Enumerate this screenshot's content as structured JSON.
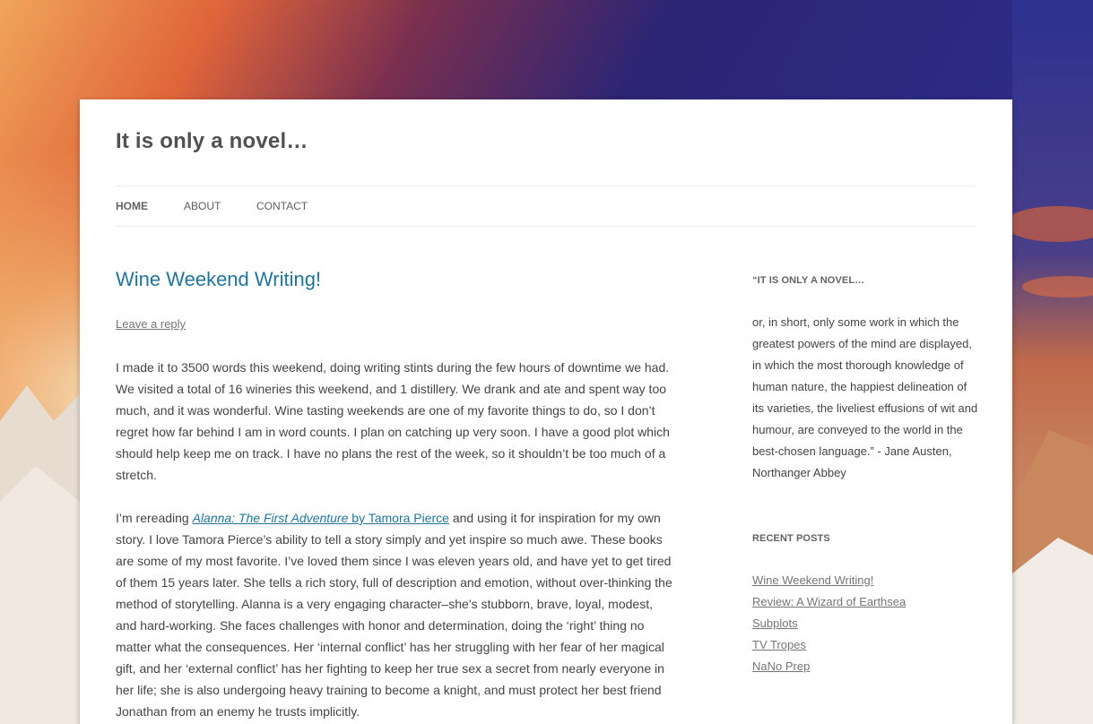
{
  "site": {
    "title": "It is only a novel…"
  },
  "nav": {
    "items": [
      {
        "label": "HOME",
        "current": true
      },
      {
        "label": "ABOUT",
        "current": false
      },
      {
        "label": "CONTACT",
        "current": false
      }
    ]
  },
  "post": {
    "title": "Wine Weekend Writing!",
    "leave_reply": "Leave a reply",
    "p1": "I made it to 3500 words this weekend, doing writing stints during the few hours of downtime we had. We visited a total of 16 wineries this weekend, and 1 distillery. We drank and ate and spent way too much, and it was wonderful. Wine tasting weekends are one of my favorite things to do, so I don’t regret how far behind I am in word counts. I plan on catching up very soon. I have a good plot which should help keep me on track. I have no plans the rest of the week, so it shouldn’t be too much of a stretch.",
    "p2_before": "I’m rereading ",
    "p2_link_title": "Alanna: The First Adventure",
    "p2_link_by": " by Tamora Pierce",
    "p2_after": " and using it for inspiration for my own story. I love Tamora Pierce’s ability to tell a story simply and yet inspire so much awe. These books are some of my most favorite. I’ve loved them since I was eleven years old, and have yet to get tired of them 15 years later. She tells a rich story, full of description and emotion, without over-thinking the method of storytelling. Alanna is a very engaging character–she’s stubborn, brave, loyal, modest, and hard-working. She faces challenges with honor and determination, doing the ‘right’ thing no matter what the consequences. Her ‘internal conflict’ has her struggling with her fear of her magical gift, and her ‘external conflict’ has her fighting to keep her true sex a secret from nearly everyone in her life; she is also undergoing heavy training to become a knight, and must protect her best friend Jonathan from an enemy he trusts implicitly."
  },
  "sidebar": {
    "quote_title": "“IT IS ONLY A NOVEL…",
    "quote_text": "or, in short, only some work in which the greatest powers of the mind are displayed, in which the most thorough knowledge of human nature, the happiest delineation of its varieties, the liveliest effusions of wit and humour, are conveyed to the world in the best-chosen language.” - Jane Austen, Northanger Abbey",
    "recent_title": "RECENT POSTS",
    "recent_posts": [
      "Wine Weekend Writing!",
      "Review: A Wizard of Earthsea",
      "Subplots",
      "TV Tropes",
      "NaNo Prep"
    ]
  },
  "colors": {
    "link": "#21759b",
    "sky_top": "#26216b",
    "sunset": "#e8763a"
  }
}
